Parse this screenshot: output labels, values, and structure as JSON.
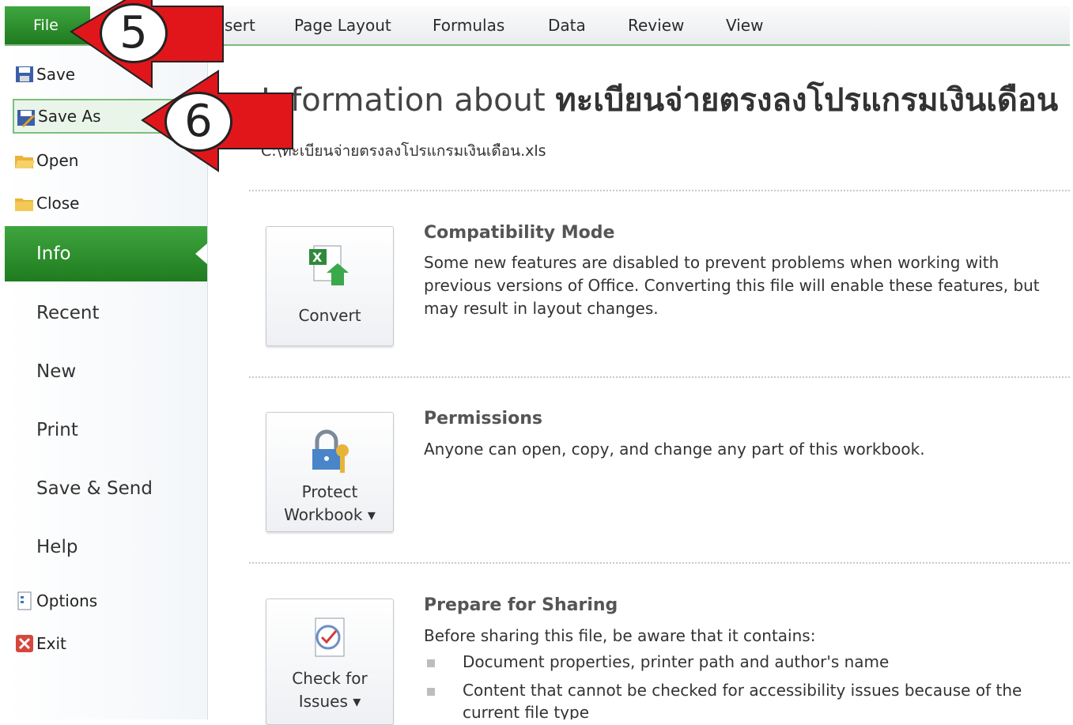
{
  "ribbon": {
    "file_tab": "File",
    "tabs": [
      "sert",
      "Page Layout",
      "Formulas",
      "Data",
      "Review",
      "View"
    ]
  },
  "backstage": {
    "commands": [
      {
        "label": "Save",
        "icon": "save-icon"
      },
      {
        "label": "Save As",
        "icon": "save-as-icon"
      },
      {
        "label": "Open",
        "icon": "open-folder-icon"
      },
      {
        "label": "Close",
        "icon": "close-folder-icon"
      }
    ],
    "nav": [
      "Info",
      "Recent",
      "New",
      "Print",
      "Save & Send",
      "Help"
    ],
    "bottom_commands": [
      {
        "label": "Options",
        "icon": "options-icon"
      },
      {
        "label": "Exit",
        "icon": "exit-icon"
      }
    ]
  },
  "info": {
    "title_prefix": "Information about",
    "workbook_name": "ทะเบียนจ่ายตรงลงโปรแกรมเงินเดือน",
    "path": "C:\\ทะเบียนจ่ายตรงลงโปรแกรมเงินเดือน.xls",
    "sections": [
      {
        "button_lines": [
          "Convert"
        ],
        "icon": "convert-excel-icon",
        "heading": "Compatibility Mode",
        "text": "Some new features are disabled to prevent problems when working with previous versions of Office. Converting this file will enable these features, but may result in layout changes."
      },
      {
        "button_lines": [
          "Protect",
          "Workbook ▾"
        ],
        "icon": "lock-key-icon",
        "heading": "Permissions",
        "text": "Anyone can open, copy, and change any part of this workbook."
      },
      {
        "button_lines": [
          "Check for",
          "Issues ▾"
        ],
        "icon": "checklist-icon",
        "heading": "Prepare for Sharing",
        "text": "Before sharing this file, be aware that it contains:",
        "bullets": [
          "Document properties, printer path and author's name",
          "Content that cannot be checked for accessibility issues because of the",
          "current file type"
        ]
      }
    ]
  },
  "annotations": {
    "step1": "5",
    "step2": "6"
  },
  "colors": {
    "accent_green": "#2e8b2e",
    "arrow_red": "#e0161b"
  }
}
